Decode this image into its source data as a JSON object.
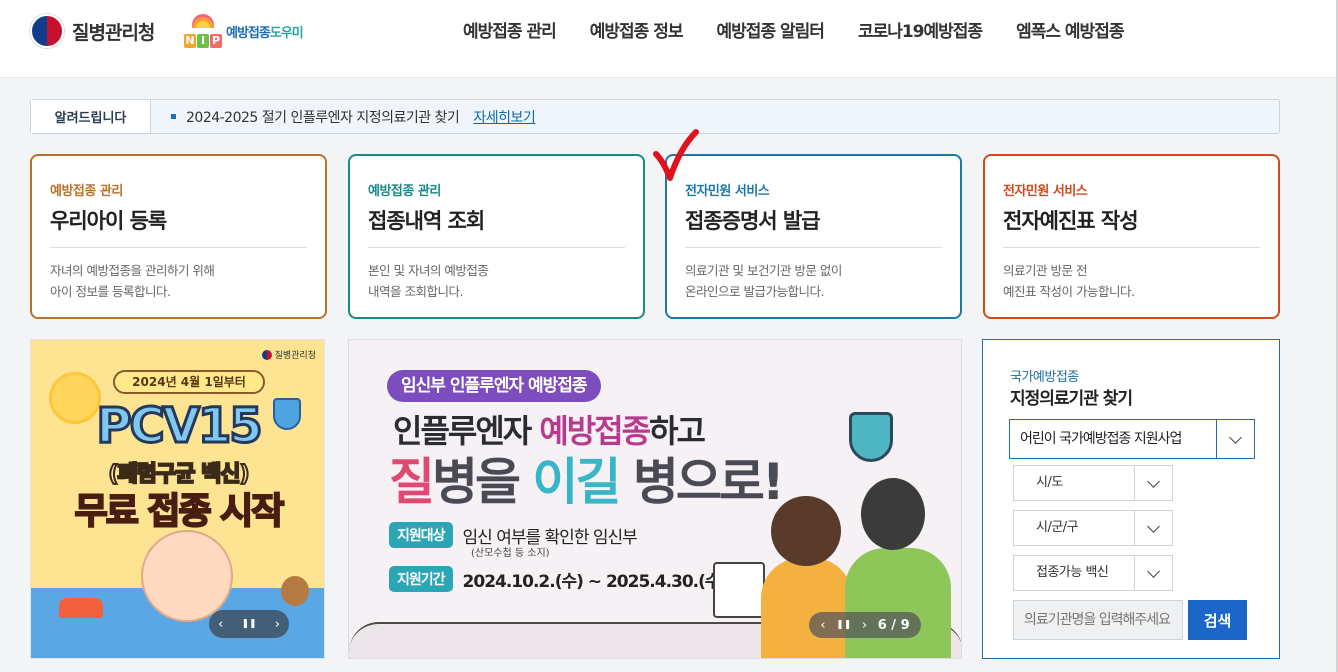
{
  "header": {
    "org_name": "질병관리청",
    "nip_letters": [
      "N",
      "I",
      "P"
    ],
    "nip_name_blue": "예방접종",
    "nip_name_teal": "도우미",
    "nav": [
      "예방접종 관리",
      "예방접종 정보",
      "예방접종 알림터",
      "코로나19예방접종",
      "엠폭스 예방접종"
    ]
  },
  "notice": {
    "title": "알려드립니다",
    "text": "2024-2025 절기 인플루엔자 지정의료기관 찾기",
    "link": "자세히보기"
  },
  "cards": [
    {
      "category": "예방접종 관리",
      "title": "우리아이 등록",
      "desc": "자녀의 예방접종을 관리하기 위해\n아이 정보를 등록합니다.",
      "color": "#b8732a"
    },
    {
      "category": "예방접종 관리",
      "title": "접종내역 조회",
      "desc": "본인 및 자녀의 예방접종\n내역을 조회합니다.",
      "color": "#1a8a87"
    },
    {
      "category": "전자민원 서비스",
      "title": "접종증명서 발급",
      "desc": "의료기관 및 보건기관 방문 없이\n온라인으로 발급가능합니다.",
      "color": "#1d78a8"
    },
    {
      "category": "전자민원 서비스",
      "title": "전자예진표 작성",
      "desc": "의료기관 방문 전\n예진표 작성이 가능합니다.",
      "color": "#d04a1c"
    }
  ],
  "pcv_banner": {
    "brand": "질병관리청",
    "date": "2024년 4월 1일부터",
    "title": "PCV15",
    "subtitle": "(폐렴구균 백신)",
    "tagline": "무료 접종 시작",
    "prev": "‹",
    "pause": "❚❚",
    "next": "›"
  },
  "flu_banner": {
    "pill": "임신부 인플루엔자 예방접종",
    "line1_pre": "인플루엔자 ",
    "line1_em": "예방접종",
    "line1_post": "하고",
    "line2_a": "질",
    "line2_b": "병을 ",
    "line2_c": "이길",
    "line2_d": " 병으로!",
    "target_tag": "지원대상",
    "target_value": "임신 여부를 확인한 임신부",
    "target_note": "(산모수첩 등 소지)",
    "period_tag": "지원기간",
    "period_value": "2024.10.2.(수) ~ 2025.4.30.(수)",
    "prev": "‹",
    "pause": "❚❚",
    "next": "›",
    "page": "6 / 9"
  },
  "search_panel": {
    "category": "국가예방접종",
    "title": "지정의료기관 찾기",
    "program_select": "어린이 국가예방접종 지원사업",
    "sido_select": "시/도",
    "sigungu_select": "시/군/구",
    "vaccine_select": "접종가능 백신",
    "input_placeholder": "의료기관명을 입력해주세요",
    "search_button": "검색"
  }
}
